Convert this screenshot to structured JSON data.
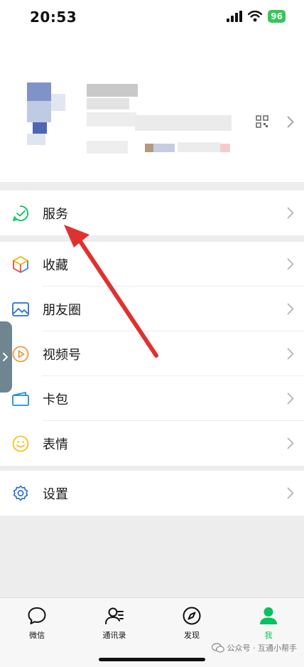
{
  "status_bar": {
    "time": "20:53",
    "battery": "96"
  },
  "menu": {
    "service": "服务",
    "items": [
      {
        "label": "收藏",
        "icon": "favorites-cube-icon"
      },
      {
        "label": "朋友圈",
        "icon": "moments-picture-icon"
      },
      {
        "label": "视频号",
        "icon": "channels-play-icon"
      },
      {
        "label": "卡包",
        "icon": "card-wallet-icon"
      },
      {
        "label": "表情",
        "icon": "sticker-smile-icon"
      }
    ],
    "settings": "设置"
  },
  "tabbar": {
    "tabs": [
      {
        "label": "微信",
        "icon": "chat-bubble-icon"
      },
      {
        "label": "通讯录",
        "icon": "contacts-icon"
      },
      {
        "label": "发现",
        "icon": "compass-icon"
      },
      {
        "label": "我",
        "icon": "me-person-icon"
      }
    ],
    "active_color": "#07c160"
  },
  "watermark": "公众号 · 互通小帮手",
  "colors": {
    "arrow": "#e03030",
    "green": "#07c160"
  }
}
